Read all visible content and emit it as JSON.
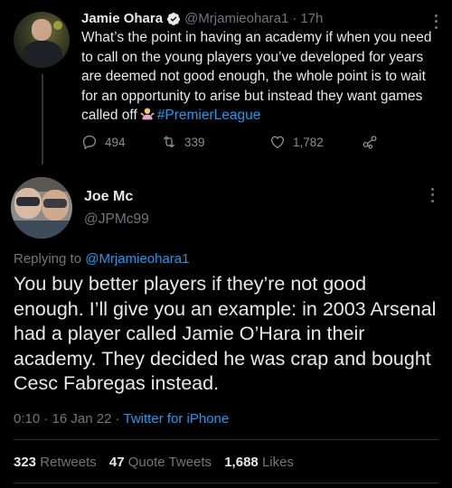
{
  "parent_tweet": {
    "display_name": "Jamie Ohara",
    "handle": "@Mrjamieohara1",
    "separator": "·",
    "time": "17h",
    "text_main": "What’s the point in having an academy if when you need to call on the young players you’ve developed for years are deemed not good enough, the whole point is to wait for an opportunity to arise but instead they want games called off",
    "emoji": "person-shrugging-emoji",
    "hashtag": "#PremierLeague",
    "reply_count": "494",
    "retweet_count": "339",
    "like_count": "1,782"
  },
  "main_tweet": {
    "display_name": "Joe Mc",
    "handle": "@JPMc99",
    "replying_prefix": "Replying to",
    "replying_to": "@Mrjamieohara1",
    "text": "You buy better players if they’re not good enough. I’ll give you an example: in 2003 Arsenal had a player called Jamie O’Hara in their academy. They decided he was crap and bought Cesc Fabregas instead.",
    "time": "0:10",
    "separator": "·",
    "date": "16 Jan 22",
    "source": "Twitter for iPhone",
    "retweets_count": "323",
    "retweets_label": "Retweets",
    "quotes_count": "47",
    "quotes_label": "Quote Tweets",
    "likes_count": "1,688",
    "likes_label": "Likes"
  },
  "colors": {
    "background": "#000000",
    "text": "#e7e9ea",
    "muted": "#71767b",
    "accent": "#1d9bf0",
    "divider": "#2f3336"
  }
}
